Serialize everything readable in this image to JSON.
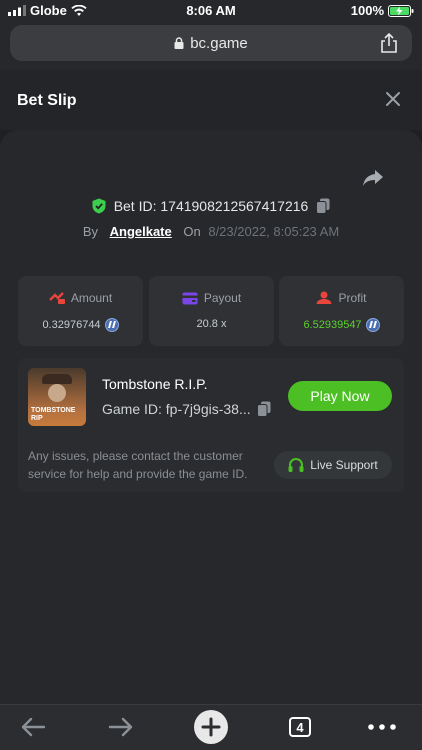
{
  "status": {
    "carrier": "Globe",
    "time": "8:06 AM",
    "battery": "100%"
  },
  "browser": {
    "url": "bc.game"
  },
  "header": {
    "title": "Bet Slip"
  },
  "bet": {
    "id_label": "Bet ID: 1741908212567417216",
    "by_label": "By",
    "user": "Angelkate",
    "on_label": "On",
    "date": "8/23/2022, 8:05:23 AM"
  },
  "stats": {
    "amount": {
      "label": "Amount",
      "value": "0.32976744"
    },
    "payout": {
      "label": "Payout",
      "value": "20.8 x"
    },
    "profit": {
      "label": "Profit",
      "value": "6.52939547"
    }
  },
  "game": {
    "name": "Tombstone R.I.P.",
    "id": "Game ID: fp-7j9gis-38...",
    "thumb_text_line1": "TOMBSTONE",
    "thumb_text_line2": "RIP",
    "play_label": "Play Now",
    "issue_text": "Any issues, please contact the customer service for help and provide the game ID.",
    "support_label": "Live Support"
  },
  "toolbar": {
    "tab_count": "4"
  },
  "colors": {
    "accent_green": "#4bbf23",
    "profit_green": "#5dd12e",
    "bg": "#1e2022"
  }
}
